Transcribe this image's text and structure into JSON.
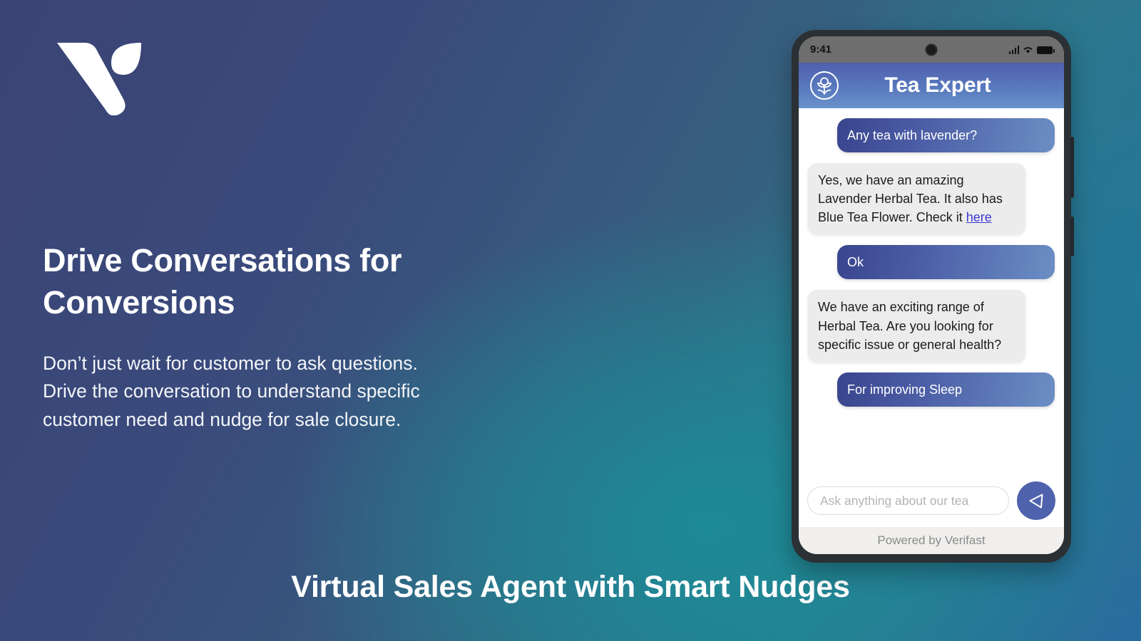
{
  "brand": {
    "logo_name": "verifast-logo",
    "accent_indigo": "#3b4475",
    "accent_teal": "#1c8c98",
    "bubble_user_start": "#39458d",
    "bubble_user_end": "#6b8ec4",
    "send_button_color": "#4f62ad",
    "link_color": "#3a3ad0"
  },
  "hero": {
    "headline": "Drive Conversations for Conversions",
    "body_lines": [
      "Don’t just wait for customer to ask questions.",
      "Drive the conversation to understand specific",
      "customer need and nudge for sale closure."
    ]
  },
  "caption": "Virtual Sales Agent with Smart Nudges",
  "phone": {
    "status_bar": {
      "time": "9:41",
      "signal_icon": "cellular-signal-icon",
      "wifi_icon": "wifi-icon",
      "battery_icon": "battery-full-icon",
      "camera_icon": "front-camera-icon"
    },
    "chat_header": {
      "title": "Tea Expert",
      "avatar_icon": "tea-flower-icon"
    },
    "messages": [
      {
        "sender": "user",
        "text": "Any tea with lavender?"
      },
      {
        "sender": "bot",
        "text_before_link": "Yes, we have an amazing Lavender Herbal Tea. It also has Blue Tea Flower. Check it ",
        "link_text": "here"
      },
      {
        "sender": "user",
        "text": "Ok"
      },
      {
        "sender": "bot",
        "text_before_link": "We have an exciting range of Herbal Tea. Are you looking for specific issue or general health?",
        "link_text": ""
      },
      {
        "sender": "user",
        "text": "For improving Sleep"
      }
    ],
    "composer": {
      "placeholder": "Ask anything about our tea",
      "value": "",
      "send_icon": "send-paper-plane-icon"
    },
    "footer": "Powered by Verifast"
  }
}
